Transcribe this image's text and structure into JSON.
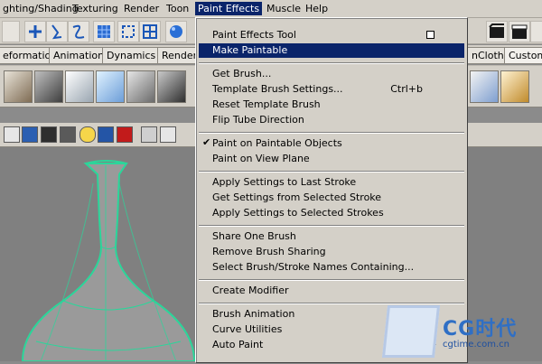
{
  "menubar": {
    "items": [
      {
        "label": "ghting/Shading"
      },
      {
        "label": "Texturing"
      },
      {
        "label": "Render"
      },
      {
        "label": "Toon"
      },
      {
        "label": "Paint Effects"
      },
      {
        "label": "Muscle"
      },
      {
        "label": "Help"
      }
    ]
  },
  "shelf_tabs": [
    "eformation",
    "Animation",
    "Dynamics",
    "Renderi",
    "nCloth",
    "Custom"
  ],
  "paint_effects_menu": {
    "items": [
      {
        "label": "Paint Effects Tool"
      },
      {
        "label": "Make Paintable"
      },
      {
        "label": "Get Brush..."
      },
      {
        "label": "Template Brush Settings...",
        "shortcut": "Ctrl+b"
      },
      {
        "label": "Reset Template Brush"
      },
      {
        "label": "Flip Tube Direction"
      },
      {
        "label": "Paint on Paintable Objects"
      },
      {
        "label": "Paint on View Plane"
      },
      {
        "label": "Apply Settings to Last Stroke"
      },
      {
        "label": "Get Settings from Selected Stroke"
      },
      {
        "label": "Apply Settings to Selected Strokes"
      },
      {
        "label": "Share One Brush"
      },
      {
        "label": "Remove Brush Sharing"
      },
      {
        "label": "Select Brush/Stroke Names Containing..."
      },
      {
        "label": "Create Modifier"
      },
      {
        "label": "Brush Animation"
      },
      {
        "label": "Curve Utilities"
      },
      {
        "label": "Auto Paint"
      }
    ]
  },
  "watermark": {
    "brand": "CG时代",
    "site": "cgtime.com.cn"
  },
  "colors": {
    "highlight": "#0a246a",
    "ui_gray": "#d4d0c8",
    "wire": "#2bd69a",
    "mesh": "#9a9a9a"
  }
}
